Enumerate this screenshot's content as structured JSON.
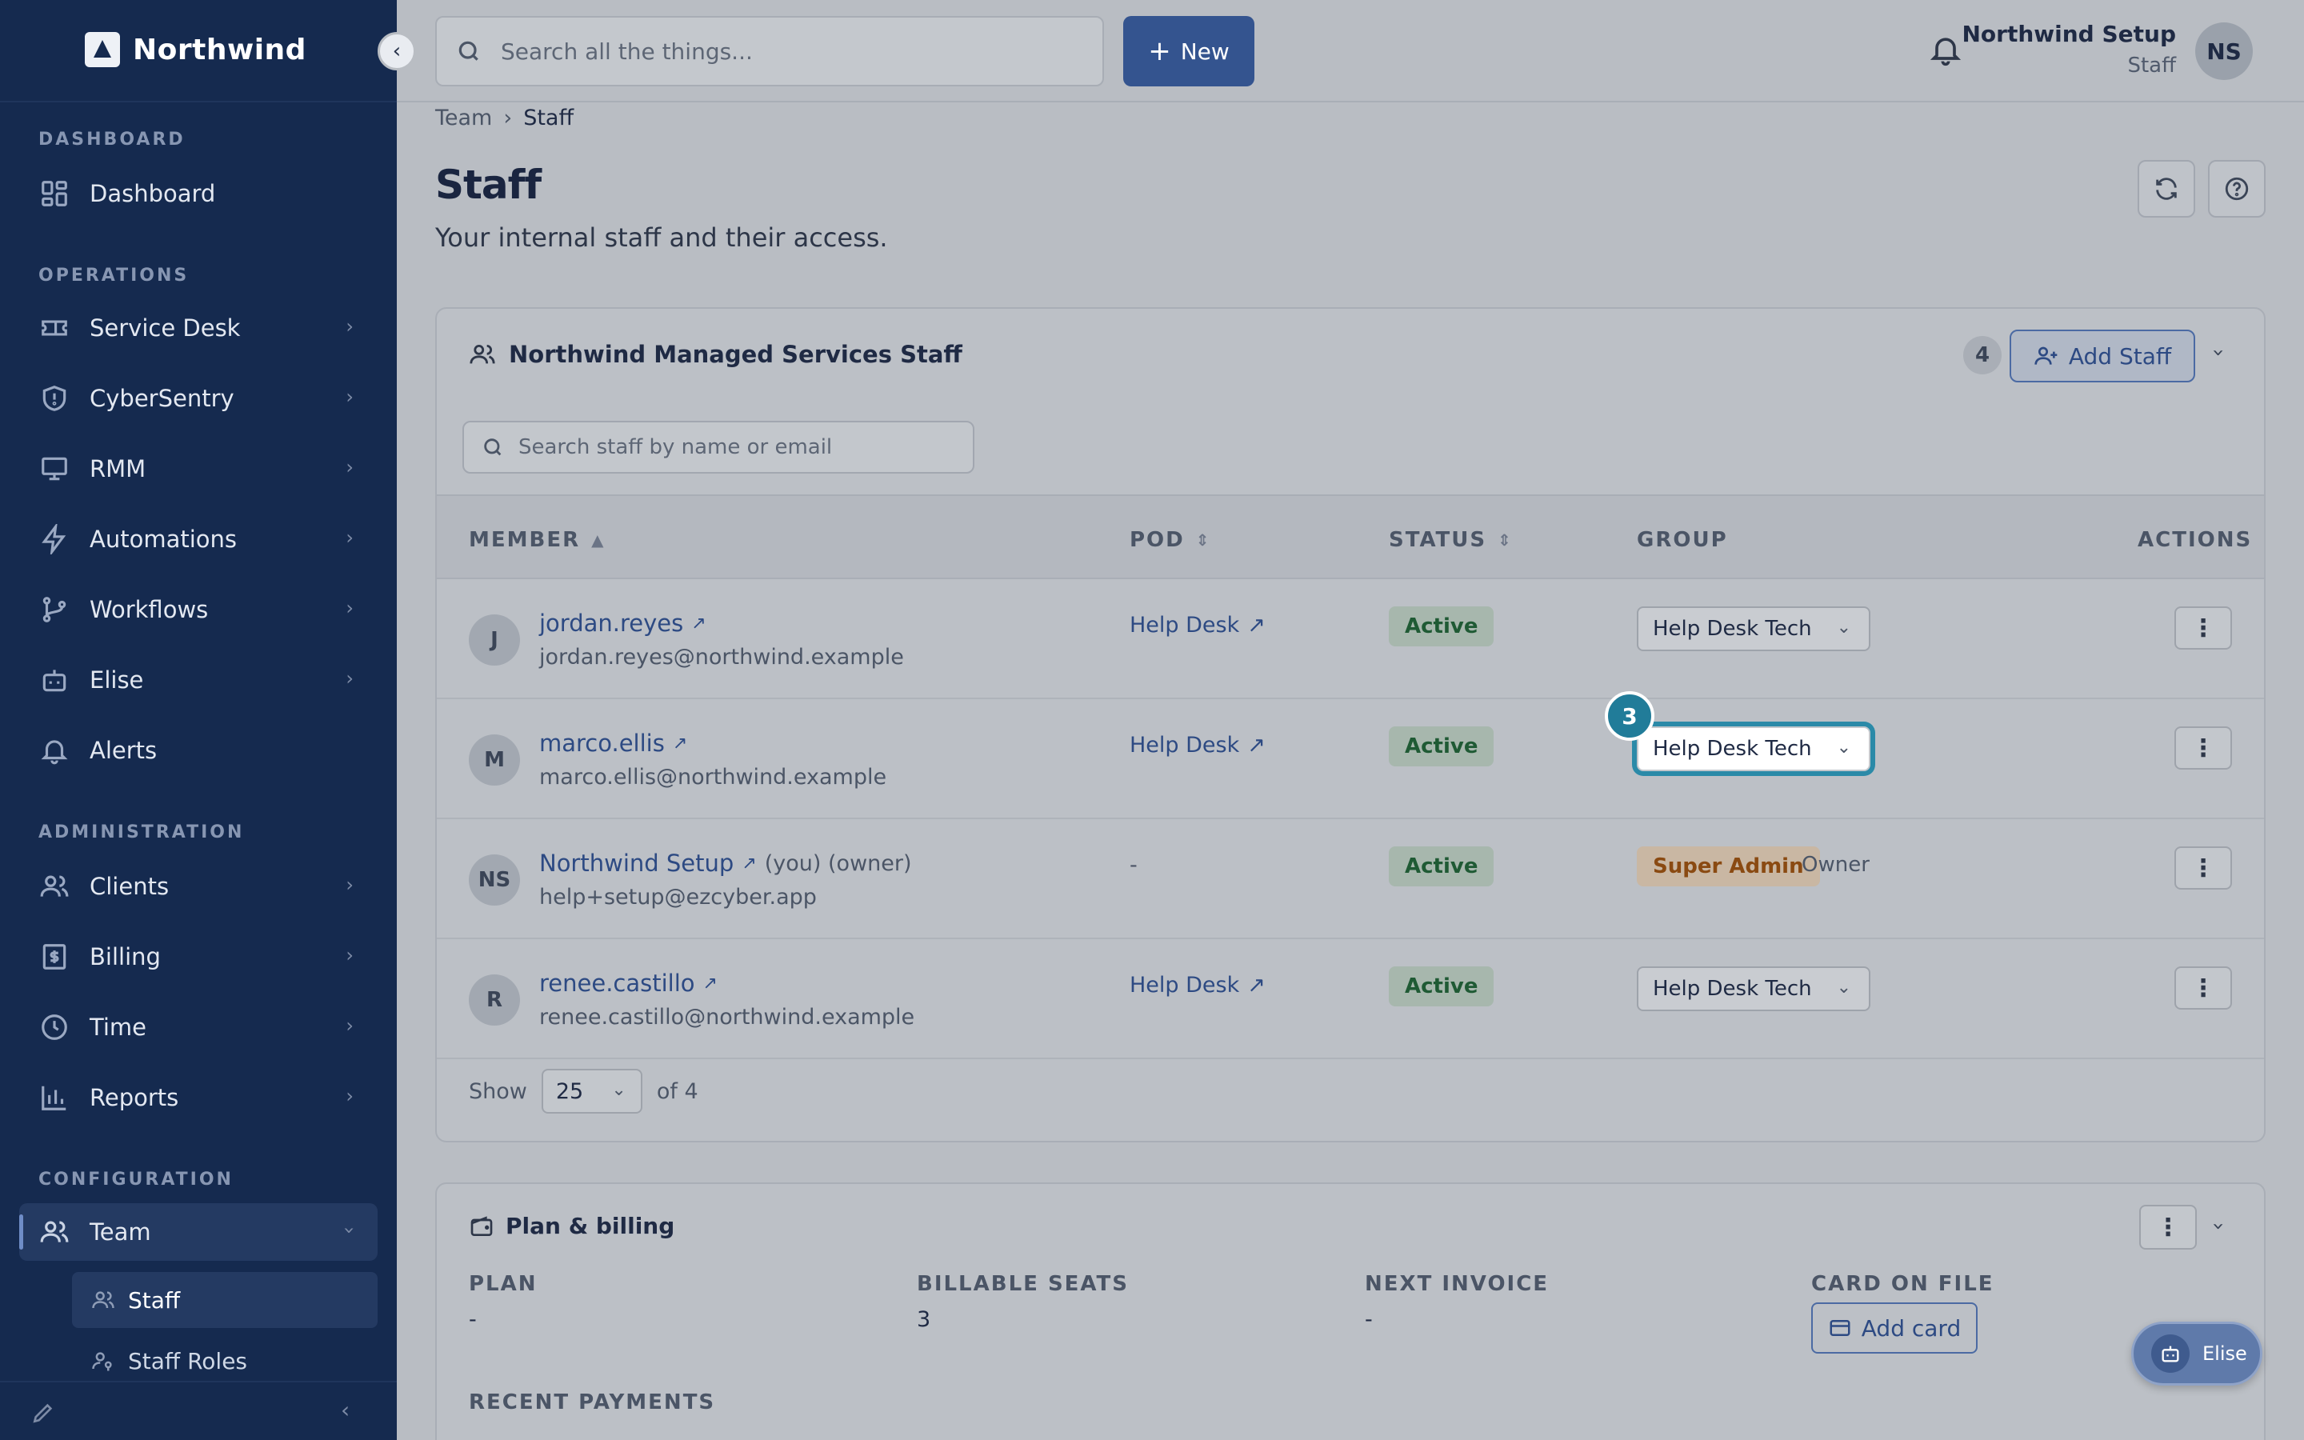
{
  "app": {
    "name": "Northwind"
  },
  "sidebar": {
    "sections": {
      "dashboard": "DASHBOARD",
      "operations": "OPERATIONS",
      "administration": "ADMINISTRATION",
      "configuration": "CONFIGURATION"
    },
    "items": {
      "dashboard": "Dashboard",
      "service_desk": "Service Desk",
      "cybersentry": "CyberSentry",
      "rmm": "RMM",
      "automations": "Automations",
      "workflows": "Workflows",
      "elise": "Elise",
      "alerts": "Alerts",
      "clients": "Clients",
      "billing": "Billing",
      "time": "Time",
      "reports": "Reports",
      "team": "Team"
    },
    "sub_items": {
      "staff": "Staff",
      "staff_roles": "Staff Roles"
    }
  },
  "topbar": {
    "search_placeholder": "Search all the things...",
    "new_label": "New",
    "user_name": "Northwind Setup",
    "user_role": "Staff",
    "user_initials": "NS"
  },
  "breadcrumb": {
    "parent": "Team",
    "current": "Staff"
  },
  "page": {
    "title": "Staff",
    "subtitle": "Your internal staff and their access."
  },
  "staff_card": {
    "title": "Northwind Managed Services Staff",
    "count": "4",
    "add_label": "Add Staff",
    "search_placeholder": "Search staff by name or email",
    "columns": {
      "member": "MEMBER",
      "pod": "POD",
      "status": "STATUS",
      "group": "GROUP",
      "actions": "ACTIONS"
    },
    "rows": [
      {
        "initials": "J",
        "name": "jordan.reyes",
        "email": "jordan.reyes@northwind.example",
        "pod": "Help Desk",
        "status": "Active",
        "group": "Help Desk Tech"
      },
      {
        "initials": "M",
        "name": "marco.ellis",
        "email": "marco.ellis@northwind.example",
        "pod": "Help Desk",
        "status": "Active",
        "group": "Help Desk Tech",
        "step": "3"
      },
      {
        "initials": "NS",
        "name": "Northwind Setup",
        "you": "(you) (owner)",
        "email": "help+setup@ezcyber.app",
        "pod": "-",
        "status": "Active",
        "group_badge": "Super Admin",
        "group_extra": "Owner"
      },
      {
        "initials": "R",
        "name": "renee.castillo",
        "email": "renee.castillo@northwind.example",
        "pod": "Help Desk",
        "status": "Active",
        "group": "Help Desk Tech"
      }
    ],
    "pager": {
      "show": "Show",
      "size": "25",
      "total": "of 4"
    }
  },
  "plan_card": {
    "title": "Plan & billing",
    "plan_label": "PLAN",
    "plan_value": "-",
    "seats_label": "BILLABLE SEATS",
    "seats_value": "3",
    "invoice_label": "NEXT INVOICE",
    "invoice_value": "-",
    "card_label": "CARD ON FILE",
    "add_card": "Add card",
    "recent": "RECENT PAYMENTS"
  },
  "assistant": {
    "label": "Elise"
  }
}
